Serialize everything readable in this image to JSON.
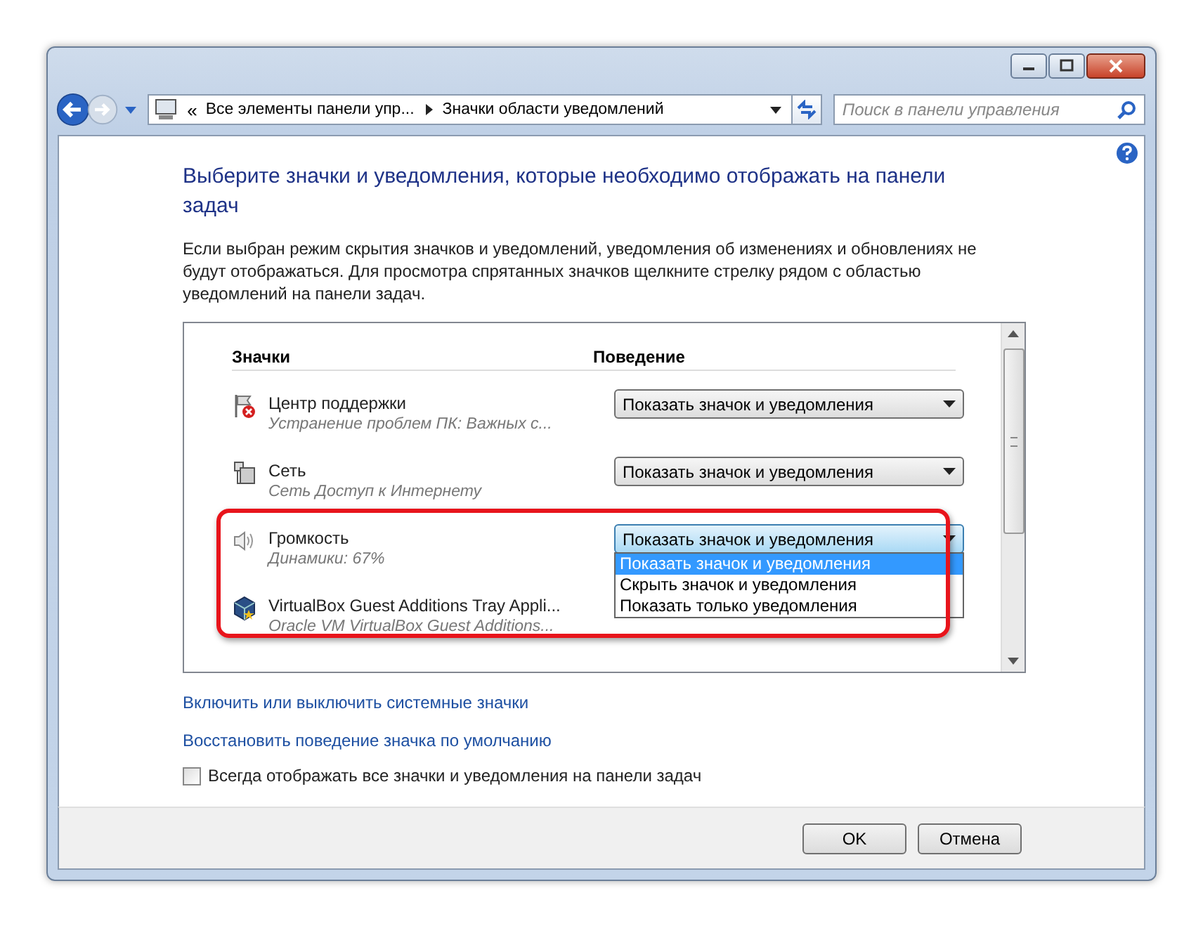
{
  "nav": {
    "chevron": "«",
    "breadcrumb": [
      "Все элементы панели упр...",
      "Значки области уведомлений"
    ],
    "search": {
      "placeholder": "Поиск в панели управления"
    }
  },
  "heading": "Выберите значки и уведомления, которые необходимо отображать на панели задач",
  "description": "Если выбран режим скрытия значков и уведомлений, уведомления об изменениях и обновлениях не будут отображаться. Для просмотра спрятанных значков щелкните стрелку рядом с областью уведомлений на панели задач.",
  "table": {
    "columns": [
      "Значки",
      "Поведение"
    ],
    "rows": [
      {
        "kind": "action-center",
        "name": "Центр поддержки",
        "detail": "Устранение проблем ПК: Важных с...",
        "behavior": "Показать значок и уведомления"
      },
      {
        "kind": "network",
        "name": "Сеть",
        "detail": "Сеть Доступ к Интернету",
        "behavior": "Показать значок и уведомления"
      },
      {
        "kind": "volume",
        "name": "Громкость",
        "detail": "Динамики: 67%",
        "behavior": "Показать значок и уведомления",
        "open": true,
        "highlighted": true,
        "options": [
          {
            "label": "Показать значок и уведомления",
            "selected": true
          },
          {
            "label": "Скрыть значок и уведомления",
            "selected": false
          },
          {
            "label": "Показать только уведомления",
            "selected": false
          }
        ]
      },
      {
        "kind": "virtualbox",
        "name": "VirtualBox Guest Additions Tray Appli...",
        "detail": "Oracle VM VirtualBox Guest Additions...",
        "highlighted": true
      }
    ]
  },
  "links": [
    "Включить или выключить системные значки",
    "Восстановить поведение значка по умолчанию"
  ],
  "checkbox": {
    "label": "Всегда отображать все значки и уведомления на панели задач",
    "checked": false
  },
  "buttons": [
    "OK",
    "Отмена"
  ]
}
